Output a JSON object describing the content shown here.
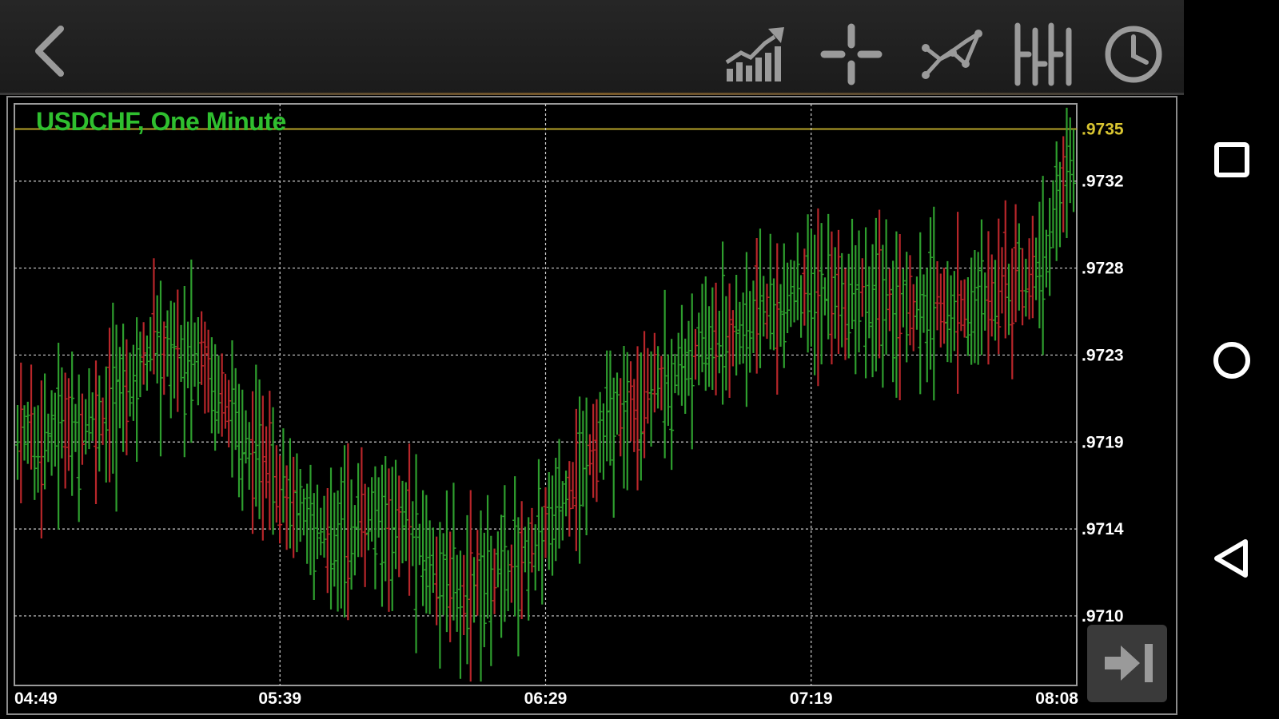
{
  "toolbar": {
    "back_icon": "back-chevron-icon",
    "icons": [
      "chart-type-icon",
      "crosshair-icon",
      "indicators-icon",
      "bar-type-icon",
      "timeframe-clock-icon"
    ]
  },
  "nav": {
    "icons": [
      "recent-apps-square-icon",
      "home-circle-icon",
      "back-triangle-icon"
    ]
  },
  "scroll_end": {
    "icon": "scroll-to-end-arrow-icon"
  },
  "colors": {
    "up": "#2e9e2e",
    "down": "#b8262a",
    "title": "#2fbf2f",
    "current_price_line": "#b6a32a",
    "current_price_label": "#d9c531"
  },
  "chart_data": {
    "type": "ohlc",
    "title": "USDCHF, One Minute",
    "ylim": [
      0.97062,
      0.97363
    ],
    "y_ticks": [
      ".9735",
      ".9732",
      ".9728",
      ".9723",
      ".9719",
      ".9714",
      ".9710"
    ],
    "y_tick_values": [
      0.9735,
      0.97323,
      0.97278,
      0.97233,
      0.97188,
      0.97143,
      0.97098
    ],
    "x_ticks": [
      "04:49",
      "05:39",
      "06:29",
      "07:19",
      "08:08"
    ],
    "current_price": 0.9735,
    "grid": true,
    "anchors": [
      {
        "t": 0,
        "v": 0.9719
      },
      {
        "t": 25,
        "v": 0.972
      },
      {
        "t": 40,
        "v": 0.9724
      },
      {
        "t": 55,
        "v": 0.9723
      },
      {
        "t": 70,
        "v": 0.9718
      },
      {
        "t": 90,
        "v": 0.9714
      },
      {
        "t": 110,
        "v": 0.9715
      },
      {
        "t": 130,
        "v": 0.9711
      },
      {
        "t": 150,
        "v": 0.9713
      },
      {
        "t": 175,
        "v": 0.972
      },
      {
        "t": 200,
        "v": 0.97235
      },
      {
        "t": 230,
        "v": 0.97265
      },
      {
        "t": 255,
        "v": 0.9726
      },
      {
        "t": 275,
        "v": 0.97255
      },
      {
        "t": 300,
        "v": 0.97275
      },
      {
        "t": 310,
        "v": 0.9734
      }
    ]
  }
}
